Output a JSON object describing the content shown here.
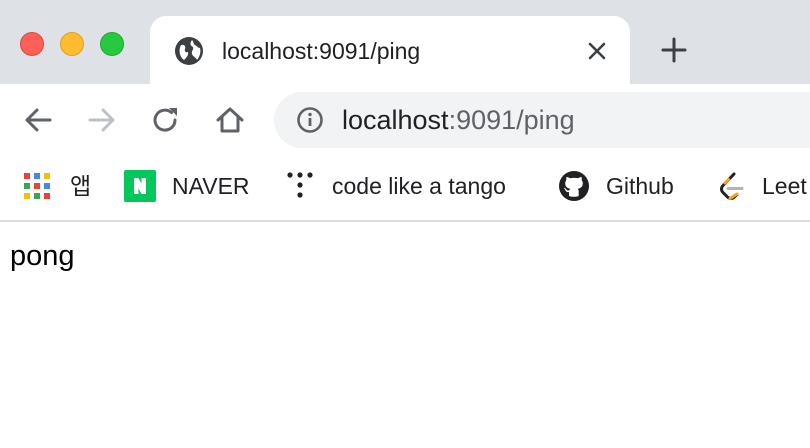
{
  "window": {
    "controls": [
      "close",
      "minimize",
      "zoom"
    ]
  },
  "tab": {
    "title": "localhost:9091/ping",
    "favicon": "globe-icon"
  },
  "toolbar": {
    "url_host": "localhost",
    "url_rest": ":9091/ping"
  },
  "bookmarks": [
    {
      "label": "앱",
      "icon": "apps-grid-icon"
    },
    {
      "label": "NAVER",
      "icon": "naver-icon"
    },
    {
      "label": "code like a tango",
      "icon": "tango-dots-icon"
    },
    {
      "label": "Github",
      "icon": "github-icon"
    },
    {
      "label": "Leet",
      "icon": "leetcode-icon"
    }
  ],
  "page": {
    "body_text": "pong"
  },
  "colors": {
    "tabstrip": "#dee1e6",
    "omnibox": "#f1f3f4",
    "naver_green": "#03c75a",
    "leetcode_orange": "#ffa116"
  }
}
